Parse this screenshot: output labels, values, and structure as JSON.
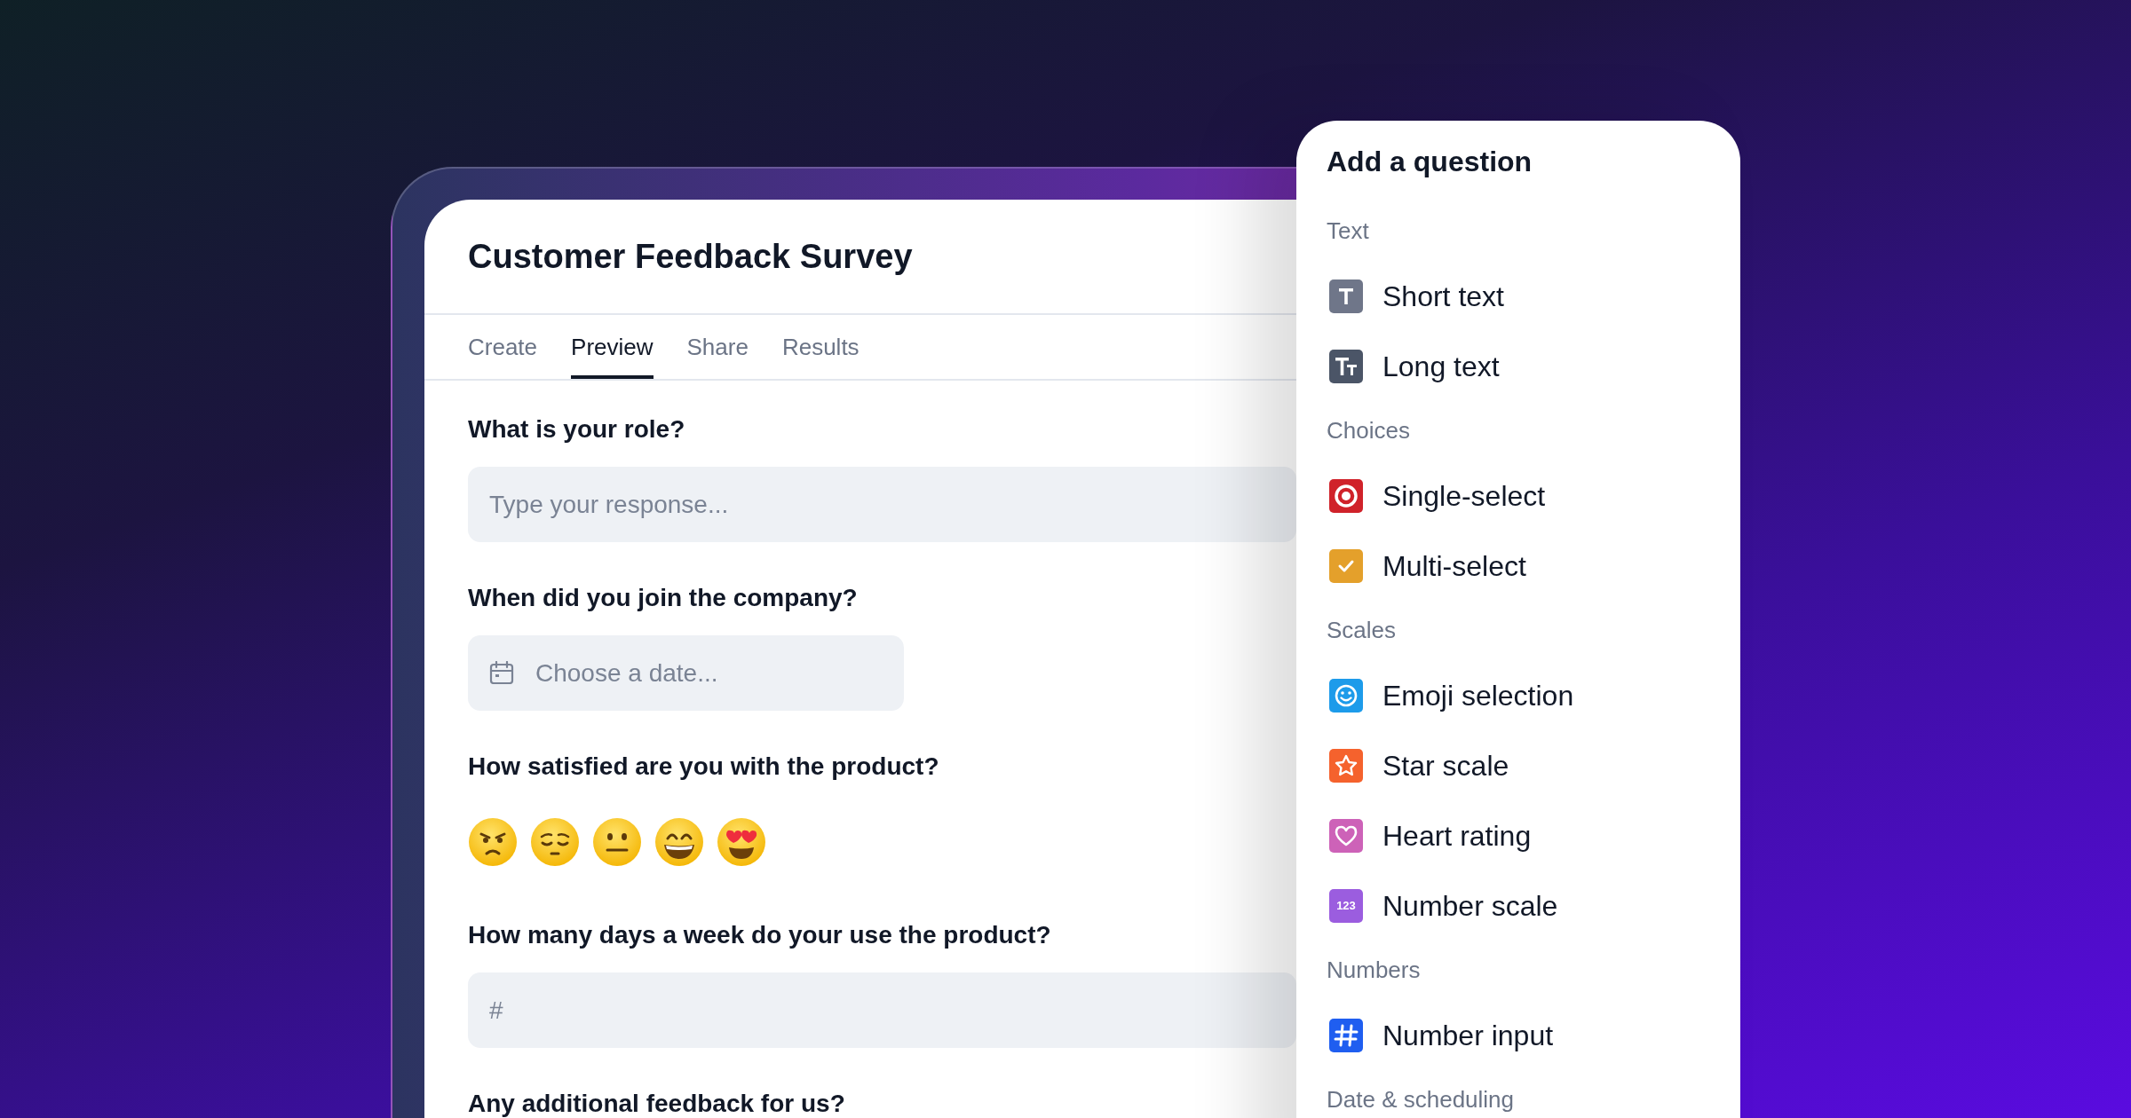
{
  "survey": {
    "title": "Customer Feedback Survey",
    "tabs": [
      {
        "label": "Create",
        "selected": false
      },
      {
        "label": "Preview",
        "selected": true
      },
      {
        "label": "Share",
        "selected": false
      },
      {
        "label": "Results",
        "selected": false
      }
    ],
    "questions": [
      {
        "kind": "text",
        "label": "What is your role?",
        "placeholder": "Type your response..."
      },
      {
        "kind": "date",
        "label": "When did you join the company?",
        "placeholder": "Choose a date..."
      },
      {
        "kind": "emoji",
        "label": "How satisfied are you with the product?",
        "options": [
          {
            "kind": "angry"
          },
          {
            "kind": "pensive"
          },
          {
            "kind": "neutral"
          },
          {
            "kind": "grin"
          },
          {
            "kind": "heart_eyes"
          }
        ]
      },
      {
        "kind": "number",
        "label": "How many days a week do your use the product?",
        "placeholder": "#"
      },
      {
        "kind": "label_only",
        "label": "Any additional feedback for us?"
      }
    ]
  },
  "panel": {
    "title": "Add a question",
    "sections": [
      {
        "label": "Text",
        "items": [
          {
            "kind": "short_text",
            "label": "Short text",
            "color": "#6f7689"
          },
          {
            "kind": "long_text",
            "label": "Long text",
            "color": "#4b5567"
          }
        ]
      },
      {
        "label": "Choices",
        "items": [
          {
            "kind": "single",
            "label": "Single-select",
            "color": "#d0222a"
          },
          {
            "kind": "multi",
            "label": "Multi-select",
            "color": "#e4a02b"
          }
        ]
      },
      {
        "label": "Scales",
        "items": [
          {
            "kind": "emoji",
            "label": "Emoji selection",
            "color": "#1d9bea"
          },
          {
            "kind": "star",
            "label": "Star scale",
            "color": "#f5622d"
          },
          {
            "kind": "heart",
            "label": "Heart rating",
            "color": "#cd62b8"
          },
          {
            "kind": "number_scale",
            "label": "Number scale",
            "color": "#9b5ddf",
            "icon_text": "123"
          }
        ]
      },
      {
        "label": "Numbers",
        "items": [
          {
            "kind": "hash",
            "label": "Number input",
            "color": "#1f5ef0"
          }
        ]
      },
      {
        "label": "Date & scheduling"
      }
    ]
  }
}
